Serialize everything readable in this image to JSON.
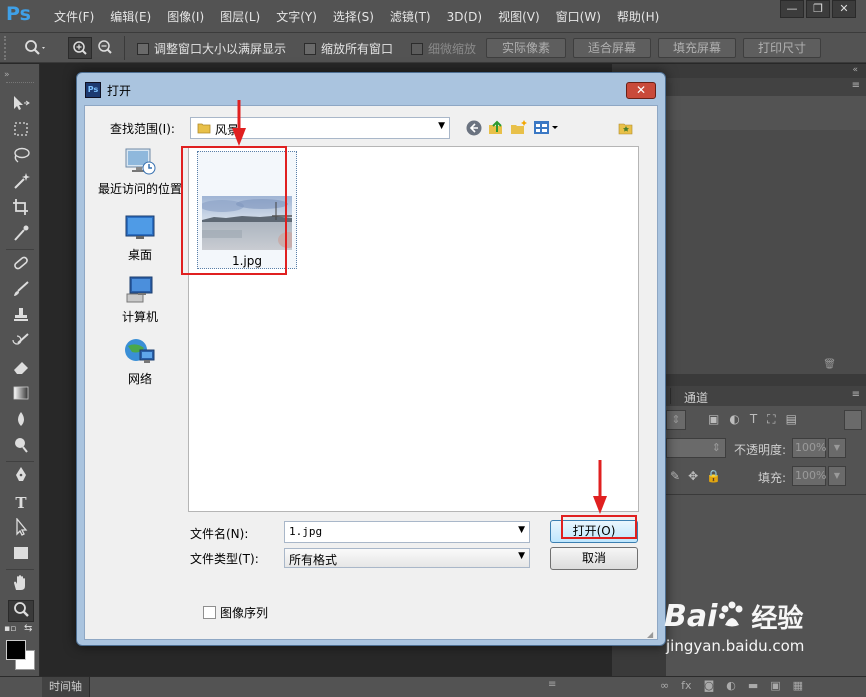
{
  "app": {
    "logo": "Ps",
    "menu": [
      "文件(F)",
      "编辑(E)",
      "图像(I)",
      "图层(L)",
      "文字(Y)",
      "选择(S)",
      "滤镜(T)",
      "3D(D)",
      "视图(V)",
      "窗口(W)",
      "帮助(H)"
    ],
    "window_controls": [
      "—",
      "❐",
      "✕"
    ]
  },
  "options_bar": {
    "fit_window_label": "调整窗口大小以满屏显示",
    "zoom_all_label": "缩放所有窗口",
    "scrubby_zoom_label": "细微缩放",
    "actual_pixels_label": "实际像素",
    "fit_screen_label": "适合屏幕",
    "fill_screen_label": "填充屏幕",
    "print_size_label": "打印尺寸"
  },
  "panels": {
    "channels_tab": "通道",
    "opacity_label": "不透明度:",
    "opacity_value": "100%",
    "fill_label": "填充:",
    "fill_value": "100%"
  },
  "status_bar": {
    "timeline_tab": "时间轴"
  },
  "dialog": {
    "title": "打开",
    "look_in_label": "查找范围(I):",
    "look_in_value": "风景",
    "places": [
      "最近访问的位置",
      "桌面",
      "计算机",
      "网络"
    ],
    "file": {
      "name": "1.jpg"
    },
    "filename_label": "文件名(N):",
    "filename_value": "1.jpg",
    "filetype_label": "文件类型(T):",
    "filetype_value": "所有格式",
    "open_button": "打开(O)",
    "cancel_button": "取消",
    "image_sequence_label": "图像序列"
  },
  "watermark": {
    "brand": "Bai",
    "brand_suffix": "经验",
    "url": "jingyan.baidu.com"
  },
  "colors": {
    "highlight_red": "#e02020",
    "dialog_frame": "#aac4df",
    "ps_blue": "#3fa0e8"
  }
}
